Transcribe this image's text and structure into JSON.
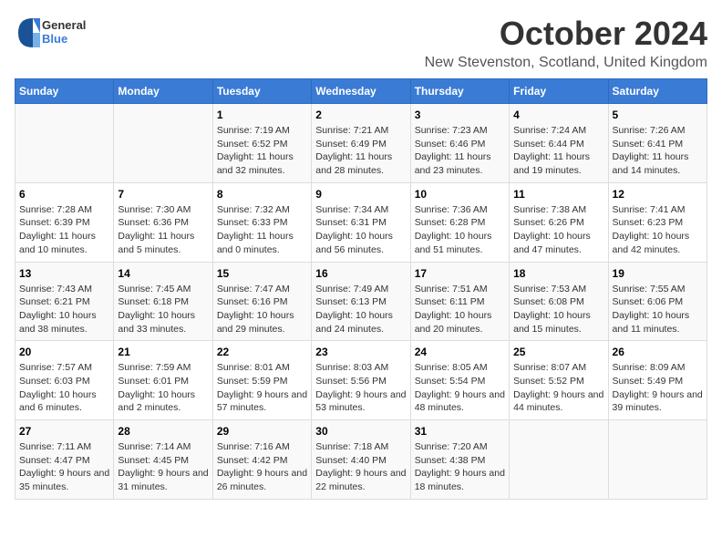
{
  "logo": {
    "general": "General",
    "blue": "Blue"
  },
  "title": "October 2024",
  "location": "New Stevenston, Scotland, United Kingdom",
  "days_of_week": [
    "Sunday",
    "Monday",
    "Tuesday",
    "Wednesday",
    "Thursday",
    "Friday",
    "Saturday"
  ],
  "weeks": [
    [
      {
        "day": "",
        "detail": ""
      },
      {
        "day": "",
        "detail": ""
      },
      {
        "day": "1",
        "detail": "Sunrise: 7:19 AM\nSunset: 6:52 PM\nDaylight: 11 hours and 32 minutes."
      },
      {
        "day": "2",
        "detail": "Sunrise: 7:21 AM\nSunset: 6:49 PM\nDaylight: 11 hours and 28 minutes."
      },
      {
        "day": "3",
        "detail": "Sunrise: 7:23 AM\nSunset: 6:46 PM\nDaylight: 11 hours and 23 minutes."
      },
      {
        "day": "4",
        "detail": "Sunrise: 7:24 AM\nSunset: 6:44 PM\nDaylight: 11 hours and 19 minutes."
      },
      {
        "day": "5",
        "detail": "Sunrise: 7:26 AM\nSunset: 6:41 PM\nDaylight: 11 hours and 14 minutes."
      }
    ],
    [
      {
        "day": "6",
        "detail": "Sunrise: 7:28 AM\nSunset: 6:39 PM\nDaylight: 11 hours and 10 minutes."
      },
      {
        "day": "7",
        "detail": "Sunrise: 7:30 AM\nSunset: 6:36 PM\nDaylight: 11 hours and 5 minutes."
      },
      {
        "day": "8",
        "detail": "Sunrise: 7:32 AM\nSunset: 6:33 PM\nDaylight: 11 hours and 0 minutes."
      },
      {
        "day": "9",
        "detail": "Sunrise: 7:34 AM\nSunset: 6:31 PM\nDaylight: 10 hours and 56 minutes."
      },
      {
        "day": "10",
        "detail": "Sunrise: 7:36 AM\nSunset: 6:28 PM\nDaylight: 10 hours and 51 minutes."
      },
      {
        "day": "11",
        "detail": "Sunrise: 7:38 AM\nSunset: 6:26 PM\nDaylight: 10 hours and 47 minutes."
      },
      {
        "day": "12",
        "detail": "Sunrise: 7:41 AM\nSunset: 6:23 PM\nDaylight: 10 hours and 42 minutes."
      }
    ],
    [
      {
        "day": "13",
        "detail": "Sunrise: 7:43 AM\nSunset: 6:21 PM\nDaylight: 10 hours and 38 minutes."
      },
      {
        "day": "14",
        "detail": "Sunrise: 7:45 AM\nSunset: 6:18 PM\nDaylight: 10 hours and 33 minutes."
      },
      {
        "day": "15",
        "detail": "Sunrise: 7:47 AM\nSunset: 6:16 PM\nDaylight: 10 hours and 29 minutes."
      },
      {
        "day": "16",
        "detail": "Sunrise: 7:49 AM\nSunset: 6:13 PM\nDaylight: 10 hours and 24 minutes."
      },
      {
        "day": "17",
        "detail": "Sunrise: 7:51 AM\nSunset: 6:11 PM\nDaylight: 10 hours and 20 minutes."
      },
      {
        "day": "18",
        "detail": "Sunrise: 7:53 AM\nSunset: 6:08 PM\nDaylight: 10 hours and 15 minutes."
      },
      {
        "day": "19",
        "detail": "Sunrise: 7:55 AM\nSunset: 6:06 PM\nDaylight: 10 hours and 11 minutes."
      }
    ],
    [
      {
        "day": "20",
        "detail": "Sunrise: 7:57 AM\nSunset: 6:03 PM\nDaylight: 10 hours and 6 minutes."
      },
      {
        "day": "21",
        "detail": "Sunrise: 7:59 AM\nSunset: 6:01 PM\nDaylight: 10 hours and 2 minutes."
      },
      {
        "day": "22",
        "detail": "Sunrise: 8:01 AM\nSunset: 5:59 PM\nDaylight: 9 hours and 57 minutes."
      },
      {
        "day": "23",
        "detail": "Sunrise: 8:03 AM\nSunset: 5:56 PM\nDaylight: 9 hours and 53 minutes."
      },
      {
        "day": "24",
        "detail": "Sunrise: 8:05 AM\nSunset: 5:54 PM\nDaylight: 9 hours and 48 minutes."
      },
      {
        "day": "25",
        "detail": "Sunrise: 8:07 AM\nSunset: 5:52 PM\nDaylight: 9 hours and 44 minutes."
      },
      {
        "day": "26",
        "detail": "Sunrise: 8:09 AM\nSunset: 5:49 PM\nDaylight: 9 hours and 39 minutes."
      }
    ],
    [
      {
        "day": "27",
        "detail": "Sunrise: 7:11 AM\nSunset: 4:47 PM\nDaylight: 9 hours and 35 minutes."
      },
      {
        "day": "28",
        "detail": "Sunrise: 7:14 AM\nSunset: 4:45 PM\nDaylight: 9 hours and 31 minutes."
      },
      {
        "day": "29",
        "detail": "Sunrise: 7:16 AM\nSunset: 4:42 PM\nDaylight: 9 hours and 26 minutes."
      },
      {
        "day": "30",
        "detail": "Sunrise: 7:18 AM\nSunset: 4:40 PM\nDaylight: 9 hours and 22 minutes."
      },
      {
        "day": "31",
        "detail": "Sunrise: 7:20 AM\nSunset: 4:38 PM\nDaylight: 9 hours and 18 minutes."
      },
      {
        "day": "",
        "detail": ""
      },
      {
        "day": "",
        "detail": ""
      }
    ]
  ]
}
